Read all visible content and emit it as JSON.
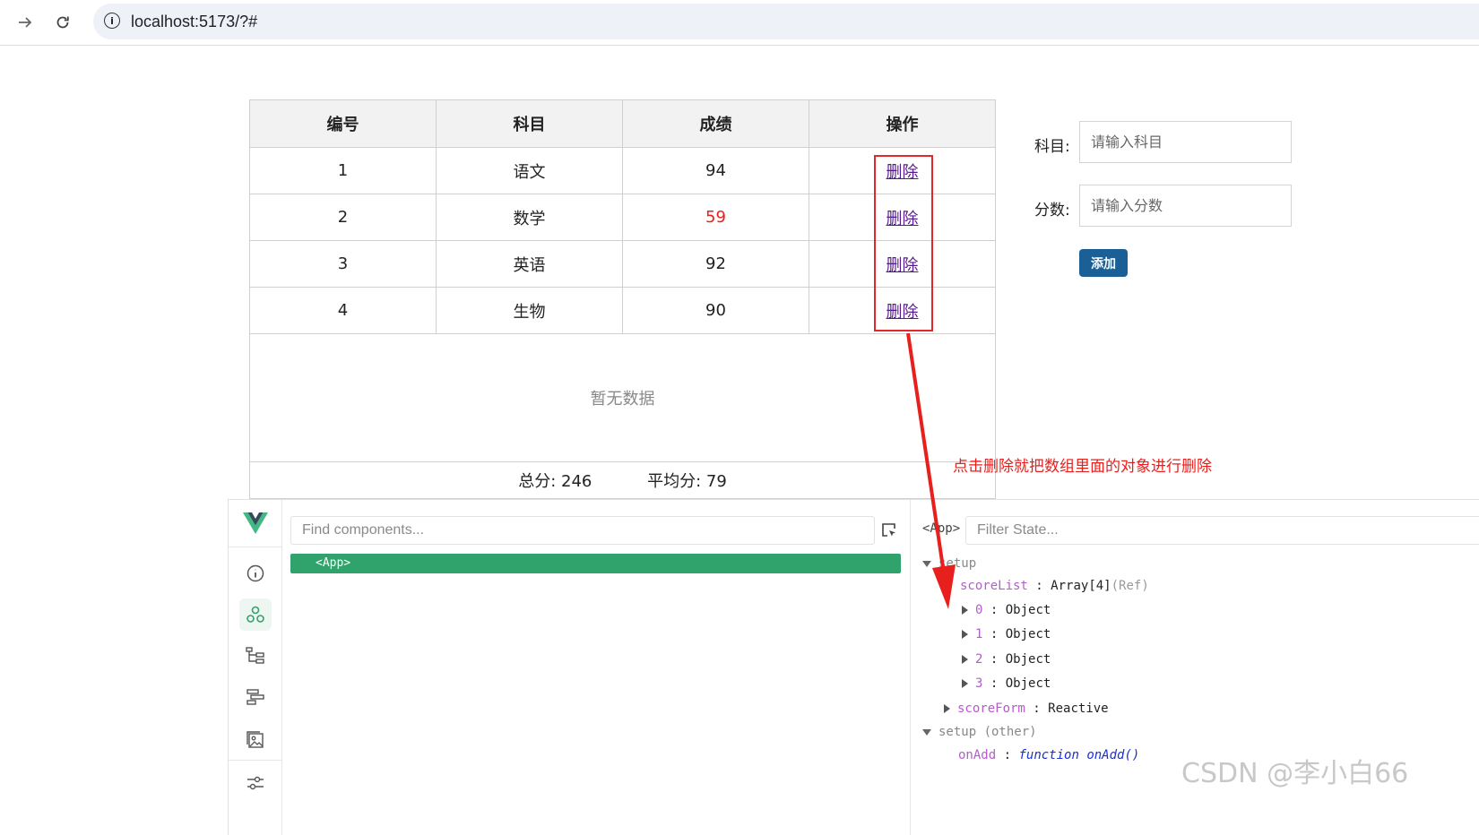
{
  "browser": {
    "url": "localhost:5173/?#"
  },
  "table": {
    "headers": [
      "编号",
      "科目",
      "成绩",
      "操作"
    ],
    "rows": [
      {
        "id": "1",
        "subject": "语文",
        "score": "94",
        "action": "删除"
      },
      {
        "id": "2",
        "subject": "数学",
        "score": "59",
        "action": "删除"
      },
      {
        "id": "3",
        "subject": "英语",
        "score": "92",
        "action": "删除"
      },
      {
        "id": "4",
        "subject": "生物",
        "score": "90",
        "action": "删除"
      }
    ],
    "empty_text": "暂无数据",
    "total_label": "总分: 246",
    "average_label": "平均分: 79",
    "fail_color": "#e8201d"
  },
  "form": {
    "subject_label": "科目:",
    "subject_placeholder": "请输入科目",
    "score_label": "分数:",
    "score_placeholder": "请输入分数",
    "add_button": "添加",
    "button_color": "#1a6096"
  },
  "annotation": {
    "text": "点击删除就把数组里面的对象进行删除",
    "color": "#e8201d"
  },
  "devtools": {
    "component_search_placeholder": "Find components...",
    "selected_component": "<App>",
    "state_crumb": "<App>",
    "state_filter_placeholder": "Filter State...",
    "accent_color": "#2fa36b",
    "state": {
      "setup_group": "setup",
      "score_list_key": "scoreList",
      "score_list_value": "Array[4]",
      "score_list_meta": "(Ref)",
      "items": [
        {
          "index": "0",
          "value": "Object"
        },
        {
          "index": "1",
          "value": "Object"
        },
        {
          "index": "2",
          "value": "Object"
        },
        {
          "index": "3",
          "value": "Object"
        }
      ],
      "score_form_key": "scoreForm",
      "score_form_value": "Reactive",
      "setup_other_group": "setup (other)",
      "on_add_key": "onAdd",
      "on_add_value": "function onAdd()"
    }
  },
  "watermark": "CSDN @李小白66"
}
